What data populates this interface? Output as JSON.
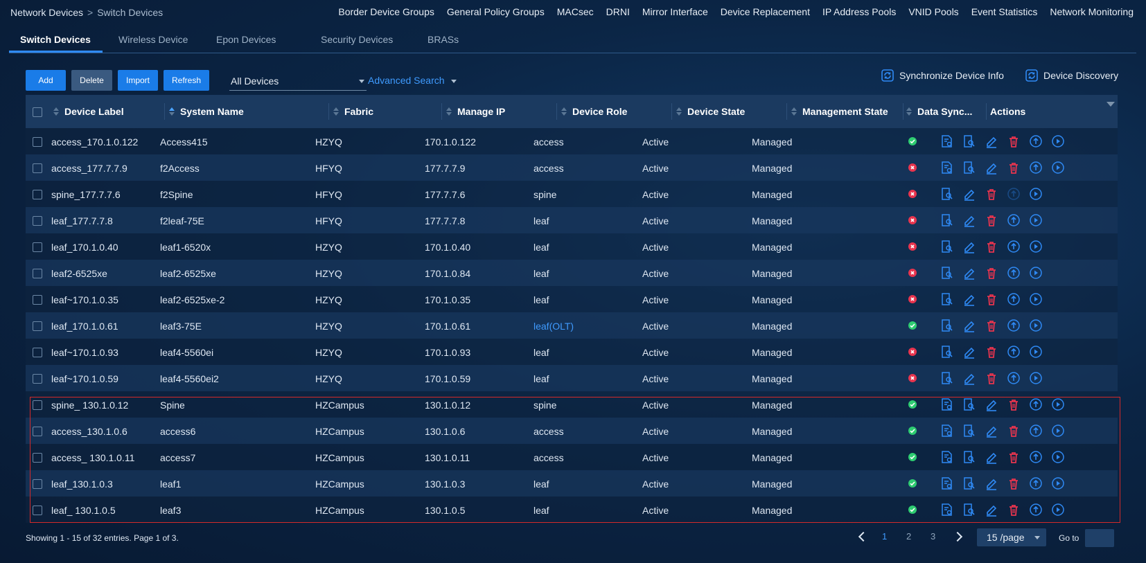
{
  "breadcrumb": {
    "parent": "Network Devices",
    "separator": ">",
    "current": "Switch Devices"
  },
  "top_nav": [
    "Border Device Groups",
    "General Policy Groups",
    "MACsec",
    "DRNI",
    "Mirror Interface",
    "Device Replacement",
    "IP Address Pools",
    "VNID Pools",
    "Event Statistics",
    "Network Monitoring"
  ],
  "tabs": [
    "Switch Devices",
    "Wireless Device",
    "Epon Devices",
    "Security Devices",
    "BRASs"
  ],
  "toolbar": {
    "add": "Add",
    "delete": "Delete",
    "import": "Import",
    "refresh": "Refresh",
    "filter_value": "All Devices",
    "advanced_search": "Advanced Search",
    "sync": "Synchronize Device Info",
    "discovery": "Device Discovery"
  },
  "columns": [
    "Device Label",
    "System Name",
    "Fabric",
    "Manage IP",
    "Device Role",
    "Device State",
    "Management State",
    "Data Sync...",
    "Actions"
  ],
  "colors": {
    "accent": "#1a7ce8",
    "ok": "#2ecc71",
    "error": "#e8344e",
    "highlight_border": "#d42a2a"
  },
  "rows": [
    {
      "label": "access_170.1.0.122",
      "system": "Access415",
      "fabric": "HZYQ",
      "ip": "170.1.0.122",
      "role": "access",
      "state": "Active",
      "mgmt": "Managed",
      "sync": "ok"
    },
    {
      "label": "access_177.7.7.9",
      "system": "f2Access",
      "fabric": "HFYQ",
      "ip": "177.7.7.9",
      "role": "access",
      "state": "Active",
      "mgmt": "Managed",
      "sync": "error"
    },
    {
      "label": "spine_177.7.7.6",
      "system": "f2Spine",
      "fabric": "HFYQ",
      "ip": "177.7.7.6",
      "role": "spine",
      "state": "Active",
      "mgmt": "Managed",
      "sync": "error"
    },
    {
      "label": "leaf_177.7.7.8",
      "system": "f2leaf-75E",
      "fabric": "HFYQ",
      "ip": "177.7.7.8",
      "role": "leaf",
      "state": "Active",
      "mgmt": "Managed",
      "sync": "error"
    },
    {
      "label": "leaf_170.1.0.40",
      "system": "leaf1-6520x",
      "fabric": "HZYQ",
      "ip": "170.1.0.40",
      "role": "leaf",
      "state": "Active",
      "mgmt": "Managed",
      "sync": "error"
    },
    {
      "label": "leaf2-6525xe",
      "system": "leaf2-6525xe",
      "fabric": "HZYQ",
      "ip": "170.1.0.84",
      "role": "leaf",
      "state": "Active",
      "mgmt": "Managed",
      "sync": "error"
    },
    {
      "label": "leaf~170.1.0.35",
      "system": "leaf2-6525xe-2",
      "fabric": "HZYQ",
      "ip": "170.1.0.35",
      "role": "leaf",
      "state": "Active",
      "mgmt": "Managed",
      "sync": "error"
    },
    {
      "label": "leaf_170.1.0.61",
      "system": "leaf3-75E",
      "fabric": "HZYQ",
      "ip": "170.1.0.61",
      "role": "leaf(OLT)",
      "state": "Active",
      "mgmt": "Managed",
      "sync": "ok"
    },
    {
      "label": "leaf~170.1.0.93",
      "system": "leaf4-5560ei",
      "fabric": "HZYQ",
      "ip": "170.1.0.93",
      "role": "leaf",
      "state": "Active",
      "mgmt": "Managed",
      "sync": "error"
    },
    {
      "label": "leaf~170.1.0.59",
      "system": "leaf4-5560ei2",
      "fabric": "HZYQ",
      "ip": "170.1.0.59",
      "role": "leaf",
      "state": "Active",
      "mgmt": "Managed",
      "sync": "error"
    },
    {
      "label": "spine_ 130.1.0.12",
      "system": "Spine",
      "fabric": "HZCampus",
      "ip": "130.1.0.12",
      "role": "spine",
      "state": "Active",
      "mgmt": "Managed",
      "sync": "ok"
    },
    {
      "label": "access_130.1.0.6",
      "system": "access6",
      "fabric": "HZCampus",
      "ip": "130.1.0.6",
      "role": "access",
      "state": "Active",
      "mgmt": "Managed",
      "sync": "ok"
    },
    {
      "label": "access_ 130.1.0.11",
      "system": "access7",
      "fabric": "HZCampus",
      "ip": "130.1.0.11",
      "role": "access",
      "state": "Active",
      "mgmt": "Managed",
      "sync": "ok"
    },
    {
      "label": "leaf_130.1.0.3",
      "system": "leaf1",
      "fabric": "HZCampus",
      "ip": "130.1.0.3",
      "role": "leaf",
      "state": "Active",
      "mgmt": "Managed",
      "sync": "ok"
    },
    {
      "label": "leaf_ 130.1.0.5",
      "system": "leaf3",
      "fabric": "HZCampus",
      "ip": "130.1.0.5",
      "role": "leaf",
      "state": "Active",
      "mgmt": "Managed",
      "sync": "ok"
    }
  ],
  "pagination": {
    "summary": "Showing 1 - 15 of 32 entries. Page 1 of 3.",
    "pages": [
      "1",
      "2",
      "3"
    ],
    "current_page": 1,
    "per_page": "15 /page",
    "goto_label": "Go to"
  }
}
